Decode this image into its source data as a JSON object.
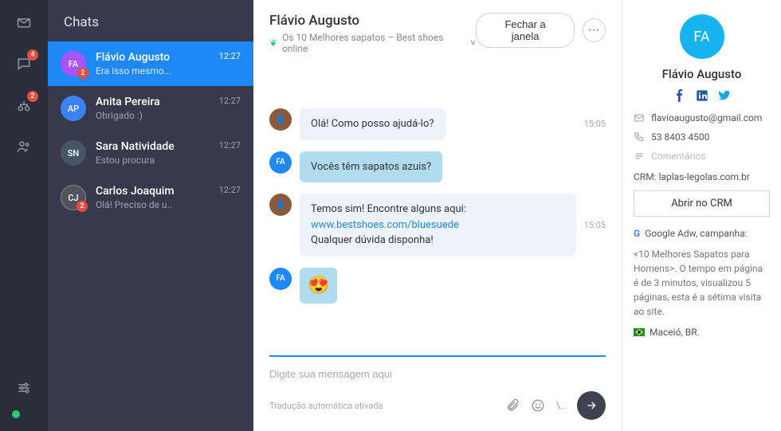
{
  "rail": {
    "chat_badge": "4",
    "bike_badge": "2"
  },
  "chats": {
    "header": "Chats",
    "items": [
      {
        "initials": "FA",
        "badge": "2",
        "name": "Flávio Augusto",
        "preview": "Era isso mesmo...",
        "time": "12:27",
        "avatar": "fa",
        "active": true
      },
      {
        "initials": "AP",
        "badge": "",
        "name": "Anita Pereira",
        "preview": "Obrigado :)",
        "time": "12:27",
        "avatar": "ap",
        "active": false
      },
      {
        "initials": "SN",
        "badge": "",
        "name": "Sara Natividade",
        "preview": "Estou procura",
        "time": "12:27",
        "avatar": "sn",
        "active": false
      },
      {
        "initials": "CJ",
        "badge": "2",
        "name": "Carlos Joaquim",
        "preview": "Olá! Preciso de u..",
        "time": "12:27",
        "avatar": "cj",
        "active": false
      }
    ]
  },
  "conversation": {
    "title": "Flávio Augusto",
    "subtitle": "Os 10 Melhores sapatos – Best shoes online",
    "close_label": "Fechar a janela",
    "messages": [
      {
        "who": "agent",
        "initials": "",
        "text": "Olá! Como posso ajudá-lo?",
        "time": "15:05",
        "link": "",
        "link_url": "",
        "text_after": ""
      },
      {
        "who": "cust",
        "initials": "FA",
        "text": "Vocês têm sapatos azuis?",
        "time": "",
        "link": "",
        "link_url": "",
        "text_after": ""
      },
      {
        "who": "agent",
        "initials": "",
        "text": "Temos sim! Encontre alguns aqui: ",
        "link": "www.bestshoes.com/bluesuede",
        "link_url": "#",
        "text_after": "Qualquer dúvida disponha!",
        "time": "15:05"
      },
      {
        "who": "cust",
        "initials": "FA",
        "text": "😍",
        "time": "",
        "emoji": true,
        "link": "",
        "link_url": "",
        "text_after": ""
      }
    ],
    "input_placeholder": "Digite sua mensagem aqui",
    "hint": "Tradução automática ativada",
    "slash": "\\.."
  },
  "info": {
    "initials": "FA",
    "name": "Flávio Augusto",
    "email": "flavioaugusto@gmail.com",
    "phone": "53 8403 4500",
    "comments_placeholder": "Comentários",
    "crm_label": "CRM: laplas-legolas.com.br",
    "crm_button": "Abrir no CRM",
    "campaign_label": "Google Adw, campanha:",
    "description": "<10 Melhores Sapatos para Homens>. O tempo em página é de 3 minutos, visualizou 5 páginas, esta é a sétima visita ao site.",
    "location": "Maceió, BR."
  }
}
